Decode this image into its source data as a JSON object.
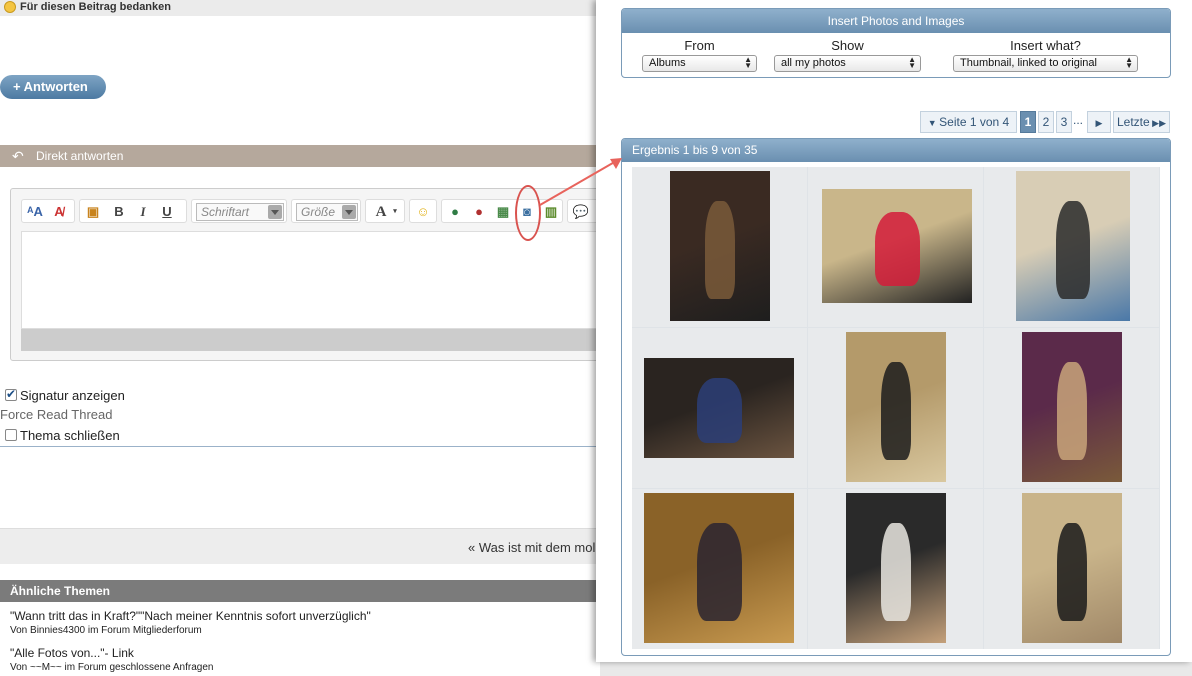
{
  "forum": {
    "thanks_label": "Für diesen Beitrag bedanken",
    "reply_plus": "+",
    "reply_label": "Antworten",
    "direct_reply_label": "Direkt antworten",
    "toolbar": {
      "font_placeholder": "Schriftart",
      "size_placeholder": "Größe",
      "bold": "B",
      "italic": "I",
      "underline": "U",
      "color": "A"
    },
    "signature_label": "Signatur anzeigen",
    "force_read_label": "Force Read Thread",
    "close_thread_label": "Thema schließen",
    "prev_thread": "« Was ist mit dem mol",
    "similar_heading": "Ähnliche Themen",
    "similar": [
      {
        "title": "\"Wann tritt das in Kraft?\"\"Nach meiner Kenntnis sofort unverzüglich\"",
        "meta": "Von Binnies4300 im Forum Mitgliederforum"
      },
      {
        "title": "\"Alle Fotos von...\"- Link",
        "meta": "Von ~~M~~ im Forum geschlossene Anfragen"
      }
    ]
  },
  "popup": {
    "title": "Insert Photos and Images",
    "from_label": "From",
    "show_label": "Show",
    "insert_label": "Insert what?",
    "from_value": "Albums",
    "show_value": "all my photos",
    "insert_value": "Thumbnail, linked to original",
    "pager": {
      "page_of": "Seite 1 von 4",
      "pages": [
        "1",
        "2",
        "3"
      ],
      "ellipsis": "...",
      "last": "Letzte"
    },
    "results_label": "Ergebnis 1 bis 9 von 35",
    "photos": [
      {
        "colors": [
          "#3a2a22",
          "#7a5a3a",
          "#1e1e1e"
        ]
      },
      {
        "colors": [
          "#c9b68a",
          "#d41c3a",
          "#222222"
        ]
      },
      {
        "colors": [
          "#d8cdb5",
          "#2a2a2a",
          "#4a78a8"
        ]
      },
      {
        "colors": [
          "#2a2420",
          "#2b3e78",
          "#6b5440"
        ]
      },
      {
        "colors": [
          "#b49a6a",
          "#1c1c1c",
          "#d9c8a0"
        ]
      },
      {
        "colors": [
          "#5b2a4a",
          "#c9a57a",
          "#7a5a3a"
        ]
      },
      {
        "colors": [
          "#8a6228",
          "#2a2430",
          "#c89a50"
        ]
      },
      {
        "colors": [
          "#2a2a2a",
          "#e9e6e0",
          "#c4a07a"
        ]
      },
      {
        "colors": [
          "#c9b48a",
          "#1a1a1a",
          "#a08868"
        ]
      }
    ]
  },
  "colors": {
    "accent": "#6a8fb0",
    "annotation": "#d9534f"
  }
}
